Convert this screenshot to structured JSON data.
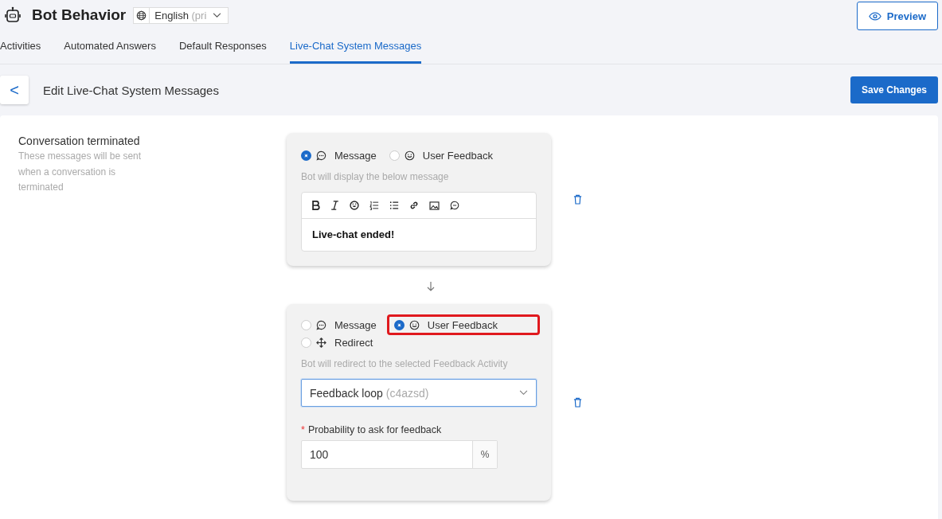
{
  "header": {
    "title": "Bot Behavior",
    "language": {
      "value": "English",
      "suffix": "(pri"
    },
    "preview": "Preview"
  },
  "tabs": [
    {
      "label": "Activities",
      "selected": false
    },
    {
      "label": "Automated Answers",
      "selected": false
    },
    {
      "label": "Default Responses",
      "selected": false
    },
    {
      "label": "Live-Chat System Messages",
      "selected": true
    }
  ],
  "toolbar": {
    "back": "<",
    "title": "Edit Live-Chat System Messages",
    "save": "Save Changes"
  },
  "section": {
    "title": "Conversation terminated",
    "description": "These messages will be sent when a conversation is terminated"
  },
  "blocks": [
    {
      "kind": "message",
      "options": [
        {
          "label": "Message",
          "kind": "message",
          "selected": true,
          "highlighted": false
        },
        {
          "label": "User Feedback",
          "kind": "feedback",
          "selected": false,
          "highlighted": false
        }
      ],
      "hint": "Bot will display the below message",
      "text": "Live-chat ended!"
    },
    {
      "kind": "feedback",
      "options": [
        {
          "label": "Message",
          "kind": "message",
          "selected": false,
          "highlighted": false
        },
        {
          "label": "User Feedback",
          "kind": "feedback",
          "selected": true,
          "highlighted": true
        },
        {
          "label": "Redirect",
          "kind": "redirect",
          "selected": false,
          "highlighted": false
        }
      ],
      "hint": "Bot will redirect to the selected Feedback Activity",
      "select": {
        "value": "Feedback loop",
        "suffix": "(c4azsd)"
      },
      "probability": {
        "label": "Probability to ask for feedback",
        "required_mark": "*",
        "value": "100",
        "unit": "%"
      }
    }
  ]
}
